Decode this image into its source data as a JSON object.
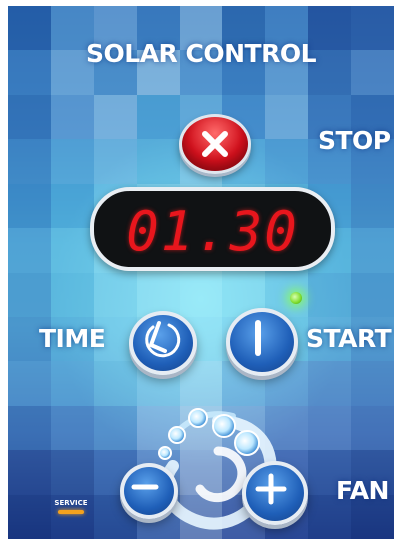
{
  "title": "SOLAR CONTROL",
  "display": {
    "time": "01.30"
  },
  "labels": {
    "stop": "STOP",
    "time": "TIME",
    "start": "START",
    "fan": "FAN",
    "service": "SERVICE"
  },
  "icons": {
    "stop": "close-x-icon",
    "time": "clock-icon",
    "start": "power-bar-icon",
    "fan_decrease": "minus-icon",
    "fan_increase": "plus-icon",
    "start_indicator": "green-led-icon"
  },
  "colors": {
    "stop_button": "#d0101c",
    "buttons": "#1f5fb8",
    "display_digits": "#e8161d",
    "start_led": "#7ddc2a",
    "service_led": "#f4a21e"
  }
}
